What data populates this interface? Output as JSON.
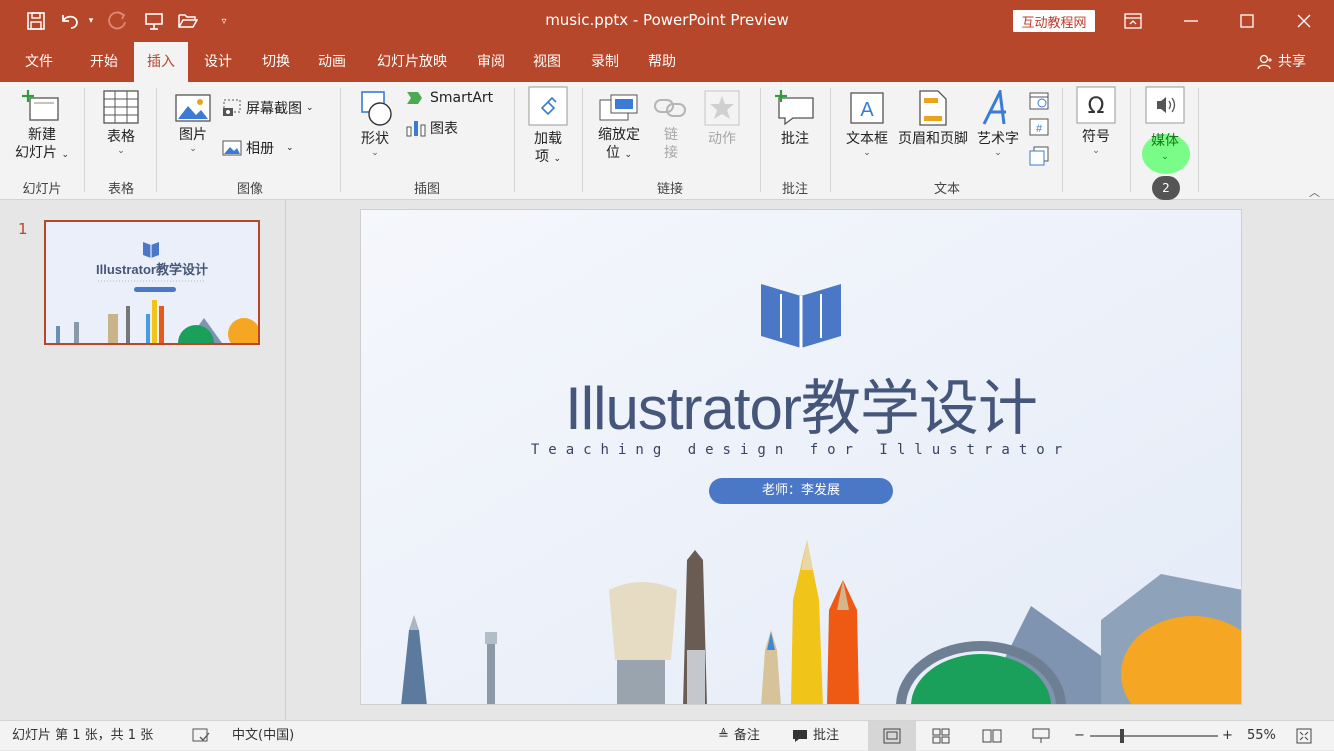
{
  "window": {
    "title": "music.pptx  -  PowerPoint Preview",
    "brand_badge": "互动教程网"
  },
  "tabs": [
    "文件",
    "开始",
    "插入",
    "设计",
    "切换",
    "动画",
    "幻灯片放映",
    "审阅",
    "视图",
    "录制",
    "帮助"
  ],
  "active_tab": "插入",
  "share_label": "共享",
  "ribbon": {
    "new_slide": "新建",
    "new_slide2": "幻灯片",
    "table": "表格",
    "pictures": "图片",
    "screenshot": "屏幕截图",
    "album": "相册",
    "shapes": "形状",
    "smartart": "SmartArt",
    "chart": "图表",
    "addins": "加载",
    "addins2": "项",
    "zoom": "缩放定",
    "zoom2": "位",
    "link": "链",
    "link2": "接",
    "action": "动作",
    "comment": "批注",
    "textbox": "文本框",
    "header_footer": "页眉和页脚",
    "wordart": "艺术字",
    "symbols": "符号",
    "media": "媒体"
  },
  "groups": {
    "slides": "幻灯片",
    "tables": "表格",
    "images": "图像",
    "illustrations": "插图",
    "links": "链接",
    "comments": "批注",
    "text": "文本"
  },
  "click_badge": "2",
  "slide_panel": {
    "number": "1"
  },
  "slide": {
    "title": "Illustrator教学设计",
    "subtitle": "Teaching design for Illustrator",
    "teacher": "老师：李发展"
  },
  "status": {
    "slide_info": "幻灯片 第 1 张，共 1 张",
    "language": "中文(中国)",
    "notes": "备注",
    "comments": "批注",
    "zoom": "55%"
  },
  "colors": {
    "accent": "#b7472a",
    "slide_blue": "#4a78c7"
  }
}
